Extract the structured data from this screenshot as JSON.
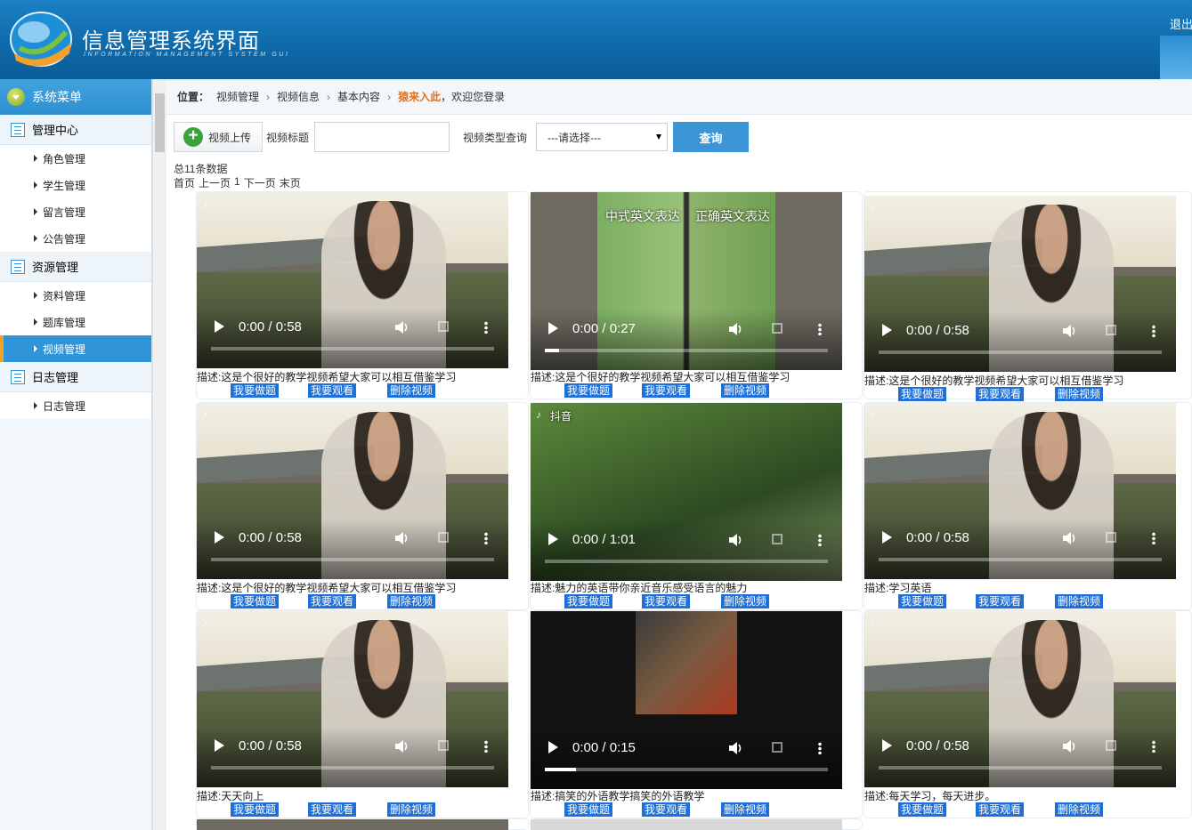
{
  "header": {
    "title": "信息管理系统界面",
    "subtitle": "INFORMATION MANAGEMENT SYSTEM GUI",
    "logout_label": "退出"
  },
  "sidebar": {
    "title": "系统菜单",
    "groups": [
      {
        "label": "管理中心",
        "items": [
          "角色管理",
          "学生管理",
          "留言管理",
          "公告管理"
        ]
      },
      {
        "label": "资源管理",
        "items": [
          "资料管理",
          "题库管理",
          "视频管理"
        ]
      },
      {
        "label": "日志管理",
        "items": [
          "日志管理"
        ]
      }
    ],
    "active_item": "视频管理"
  },
  "breadcrumb": {
    "label": "位置：",
    "items": [
      "视频管理",
      "视频信息",
      "基本内容"
    ],
    "user": "猿来入此",
    "welcome": "，欢迎您登录"
  },
  "toolbar": {
    "upload_label": "视频上传",
    "title_label": "视频标题",
    "title_value": "",
    "type_label": "视频类型查询",
    "type_selected": "---请选择---",
    "query_label": "查询"
  },
  "summary": {
    "total": "总11条数据",
    "pager": [
      "首页",
      "上一页",
      "1",
      "下一页",
      "末页"
    ]
  },
  "actions": {
    "exam": "我要做题",
    "watch": "我要观看",
    "delete": "删除视频"
  },
  "videos": [
    {
      "time": "0:00 / 0:58",
      "progress": 0,
      "desc": "描述:这是个很好的教学视频希望大家可以相互借鉴学习"
    },
    {
      "time": "0:00 / 0:27",
      "progress": 0.05,
      "desc": "描述:这是个很好的教学视频希望大家可以相互借鉴学习",
      "overlay": [
        "中式英文表达",
        "正确英文表达"
      ]
    },
    {
      "time": "0:00 / 0:58",
      "progress": 0,
      "desc": "描述:这是个很好的教学视频希望大家可以相互借鉴学习"
    },
    {
      "time": "0:00 / 0:58",
      "progress": 0,
      "desc": "描述:这是个很好的教学视频希望大家可以相互借鉴学习"
    },
    {
      "time": "0:00 / 1:01",
      "progress": 0,
      "desc": "描述:魅力的英语带你亲近音乐感受语言的魅力",
      "logo": "抖音"
    },
    {
      "time": "0:00 / 0:58",
      "progress": 0,
      "desc": "描述:学习英语"
    },
    {
      "time": "0:00 / 0:58",
      "progress": 0,
      "desc": "描述:天天向上"
    },
    {
      "time": "0:00 / 0:15",
      "progress": 0.11,
      "desc": "描述:搞笑的外语教学搞笑的外语教学"
    },
    {
      "time": "0:00 / 0:58",
      "progress": 0,
      "desc": "描述:每天学习，每天进步。"
    }
  ],
  "colors": {
    "header": "#0f6bab",
    "accent": "#2f95d8",
    "button": "#1e70d8",
    "highlight": "#e4701e"
  }
}
